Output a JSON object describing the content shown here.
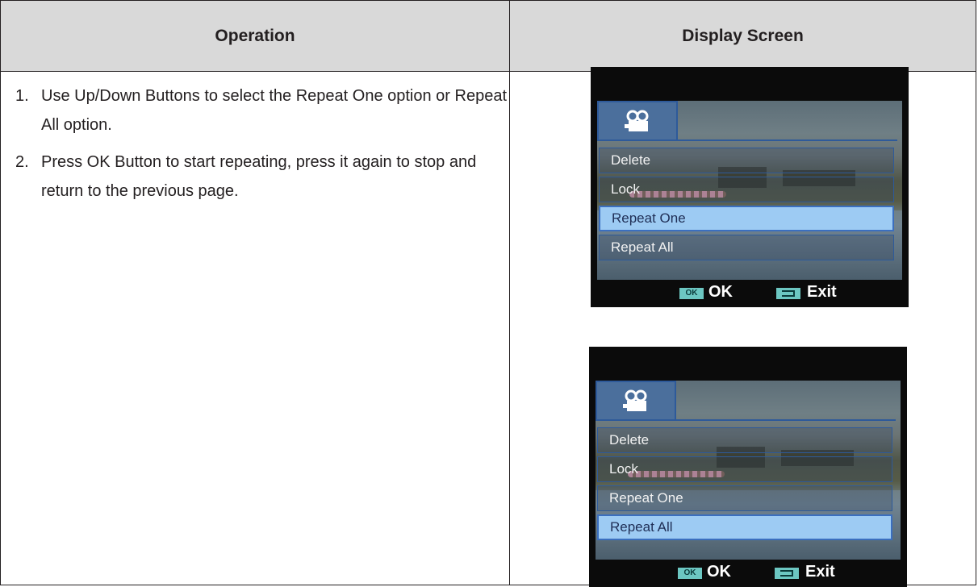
{
  "table": {
    "headers": [
      "Operation",
      "Display Screen"
    ],
    "steps": [
      {
        "number": "1.",
        "text": "Use Up/Down Buttons to select the Repeat One option or Repeat All option."
      },
      {
        "number": "2.",
        "text": "Press OK Button to start repeating, press it again to stop and return to the previous page."
      }
    ]
  },
  "screens": [
    {
      "menu": [
        "Delete",
        "Lock",
        "Repeat One",
        "Repeat  All"
      ],
      "selected": "Repeat One",
      "ok_badge": "OK",
      "ok_label": "OK",
      "exit_label": "Exit"
    },
    {
      "menu": [
        "Delete",
        "Lock",
        "Repeat One",
        "Repeat  All"
      ],
      "selected": "Repeat  All",
      "ok_badge": "OK",
      "ok_label": "OK",
      "exit_label": "Exit"
    }
  ],
  "icons": {
    "menu_tab": "movie-camera-icon",
    "ok_button": "ok-button-icon",
    "exit_button": "back-arrow-icon"
  },
  "colors": {
    "header_bg": "#d9d9d9",
    "selected_item": "#9dcbf3",
    "badge": "#6cc7c2",
    "menu_border": "#2e5a9a"
  }
}
